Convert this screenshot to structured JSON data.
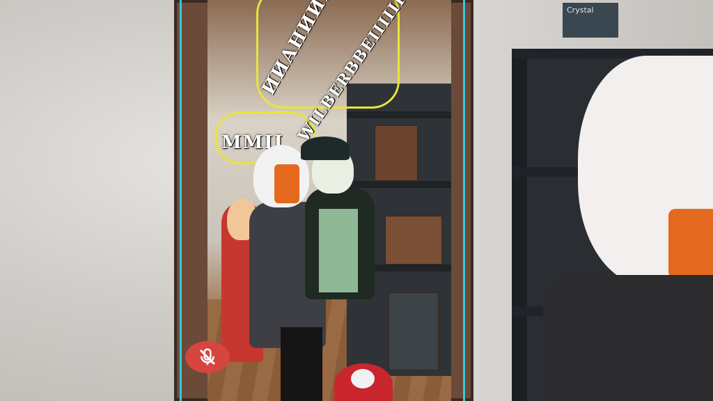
{
  "mirror": {
    "caption_top": "ИИАНИИИ",
    "caption_middle": "WILBERBBEIIIIIII",
    "caption_left": "MMII",
    "label_box_text": "Crystal"
  },
  "hud": {
    "mute_icon": "microphone-muted-icon",
    "mute_color": "#d6453f"
  },
  "colors": {
    "accent_cyan": "#35c8d8",
    "hair_orange": "#e4691f",
    "wall": "#d0ccc8"
  }
}
